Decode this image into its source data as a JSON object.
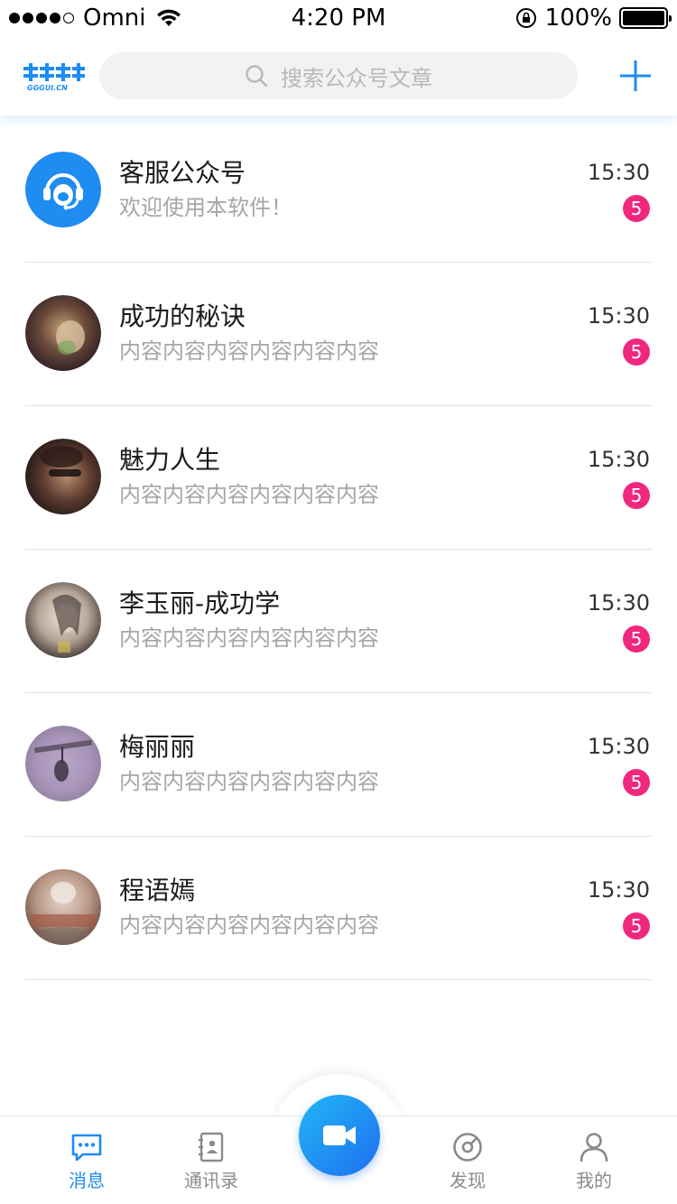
{
  "status_bar": {
    "carrier": "Omni",
    "time": "4:20 PM",
    "battery": "100%"
  },
  "header": {
    "logo_text": "GGGUI.CN",
    "search_placeholder": "搜索公众号文章",
    "accent_color": "#1e8cf0"
  },
  "messages": [
    {
      "name": "客服公众号",
      "preview": "欢迎使用本软件！",
      "time": "15:30",
      "badge": "5",
      "avatar": "support-avatar"
    },
    {
      "name": "成功的秘诀",
      "preview": "内容内容内容内容内容内容",
      "time": "15:30",
      "badge": "5",
      "avatar": "user-avatar"
    },
    {
      "name": "魅力人生",
      "preview": "内容内容内容内容内容内容",
      "time": "15:30",
      "badge": "5",
      "avatar": "user-avatar"
    },
    {
      "name": "李玉丽-成功学",
      "preview": "内容内容内容内容内容内容",
      "time": "15:30",
      "badge": "5",
      "avatar": "user-avatar"
    },
    {
      "name": "梅丽丽",
      "preview": "内容内容内容内容内容内容",
      "time": "15:30",
      "badge": "5",
      "avatar": "user-avatar"
    },
    {
      "name": "程语嫣",
      "preview": "内容内容内容内容内容内容",
      "time": "15:30",
      "badge": "5",
      "avatar": "user-avatar"
    }
  ],
  "tabbar": {
    "tabs": [
      {
        "label": "消息",
        "icon": "chat-icon",
        "active": true
      },
      {
        "label": "通讯录",
        "icon": "contacts-icon",
        "active": false
      },
      {
        "label": "发现",
        "icon": "discover-icon",
        "active": false
      },
      {
        "label": "我的",
        "icon": "profile-icon",
        "active": false
      }
    ],
    "center_button_icon": "video-icon"
  },
  "colors": {
    "badge": "#f0287d",
    "active_tab": "#1e8cf0",
    "inactive_tab": "#8a8a8a"
  }
}
